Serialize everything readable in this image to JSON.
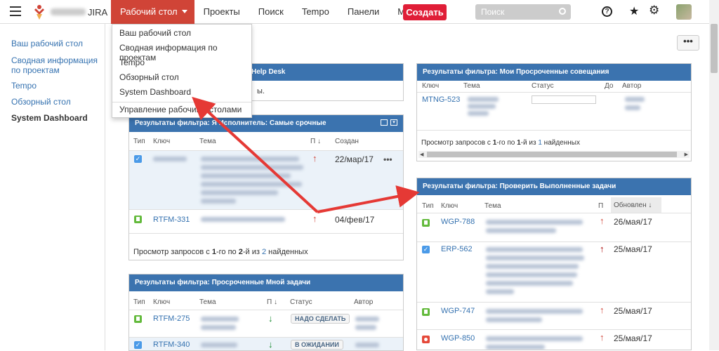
{
  "header": {
    "site_name": "JIRA",
    "nav": [
      "Рабочий стол",
      "Проекты",
      "Поиск",
      "Tempo",
      "Панели",
      "More"
    ],
    "create_label": "Создать",
    "search_placeholder": "Поиск"
  },
  "sidebar": {
    "items": [
      "Ваш рабочий стол",
      "Сводная информация по проектам",
      "Tempo",
      "Обзорный стол",
      "System Dashboard"
    ],
    "current": "System Dashboard"
  },
  "dropdown": {
    "items": [
      "Ваш рабочий стол",
      "Сводная информация по проектам",
      "Tempo",
      "Обзорный стол",
      "System Dashboard"
    ],
    "manage": "Управление рабочими столами"
  },
  "gadget_helpdesk": {
    "title_fragment": "Help Desk",
    "body_fragment": "ы."
  },
  "gadget_urgent": {
    "title": "Результаты фильтра: Я Исполнитель: Самые срочные",
    "cols": [
      "Тип",
      "Ключ",
      "Тема",
      "П",
      "Создан"
    ],
    "rows": [
      {
        "key": "",
        "date": "22/мар/17",
        "type": "task"
      },
      {
        "key": "RTFM-331",
        "date": "04/фев/17",
        "type": "story"
      }
    ],
    "footer_pre": "Просмотр запросов с ",
    "footer_from": "1",
    "footer_mid": "-го по ",
    "footer_to": "2",
    "footer_mid2": "-й из ",
    "footer_total": "2",
    "footer_post": " найденных"
  },
  "gadget_overdue_many": {
    "title": "Результаты фильтра: Просроченные Мной задачи",
    "cols": [
      "Тип",
      "Ключ",
      "Тема",
      "П",
      "Статус",
      "Автор"
    ],
    "rows": [
      {
        "key": "RTFM-275",
        "status": "НАДО СДЕЛАТЬ",
        "type": "story"
      },
      {
        "key": "RTFM-340",
        "status": "В ОЖИДАНИИ",
        "type": "task"
      }
    ]
  },
  "gadget_meetings": {
    "title": "Результаты фильтра: Мои Просроченные совещания",
    "cols": [
      "Ключ",
      "Тема",
      "Статус",
      "До",
      "Автор"
    ],
    "rows": [
      {
        "key": "MTNG-523"
      }
    ],
    "footer_pre": "Просмотр запросов с ",
    "footer_from": "1",
    "footer_mid": "-го по ",
    "footer_to": "1",
    "footer_mid2": "-й из ",
    "footer_total": "1",
    "footer_post": " найденных"
  },
  "gadget_verify": {
    "title": "Результаты фильтра: Проверить Выполненные задачи",
    "cols": [
      "Тип",
      "Ключ",
      "Тема",
      "П",
      "Обновлен"
    ],
    "rows": [
      {
        "key": "WGP-788",
        "date": "26/мая/17",
        "type": "story"
      },
      {
        "key": "ERP-562",
        "date": "25/мая/17",
        "type": "task"
      },
      {
        "key": "WGP-747",
        "date": "25/мая/17",
        "type": "story"
      },
      {
        "key": "WGP-850",
        "date": "25/мая/17",
        "type": "bug"
      }
    ]
  },
  "colors": {
    "nav_active": "#d04437",
    "create": "#e01e37",
    "gadget_header": "#3b73af",
    "link": "#3572b0",
    "annotation_arrow": "#e53935"
  }
}
